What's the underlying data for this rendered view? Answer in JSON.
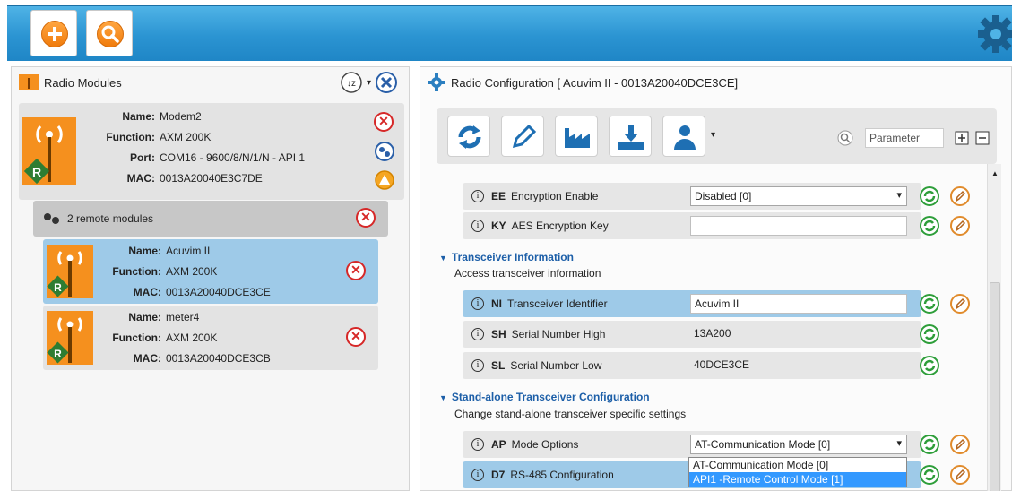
{
  "toolbar": {
    "add_label": "",
    "search_label": ""
  },
  "left_panel": {
    "title": "Radio Modules",
    "local_module": {
      "name_key": "Name:",
      "name": "Modem2",
      "function_key": "Function:",
      "function": "AXM 200K",
      "port_key": "Port:",
      "port": "COM16 - 9600/8/N/1/N - API 1",
      "mac_key": "MAC:",
      "mac": "0013A20040E3C7DE"
    },
    "remote_header": "2 remote modules",
    "remotes": [
      {
        "name_key": "Name:",
        "name": "Acuvim II",
        "function_key": "Function:",
        "function": "AXM 200K",
        "mac_key": "MAC:",
        "mac": "0013A20040DCE3CE"
      },
      {
        "name_key": "Name:",
        "name": "meter4",
        "function_key": "Function:",
        "function": "AXM 200K",
        "mac_key": "MAC:",
        "mac": "0013A20040DCE3CB"
      }
    ]
  },
  "right_panel": {
    "title": "Radio Configuration [ Acuvim II - 0013A20040DCE3CE]",
    "search_placeholder": "Parameter",
    "params": [
      {
        "code": "EE",
        "label": "Encryption Enable",
        "value": "Disabled [0]"
      },
      {
        "code": "KY",
        "label": "AES Encryption Key",
        "value": ""
      },
      {
        "code": "NI",
        "label": "Transceiver Identifier",
        "value": "Acuvim II"
      },
      {
        "code": "SH",
        "label": "Serial Number High",
        "value": "13A200"
      },
      {
        "code": "SL",
        "label": "Serial Number Low",
        "value": "40DCE3CE"
      },
      {
        "code": "AP",
        "label": "Mode Options",
        "value": "AT-Communication Mode [0]"
      },
      {
        "code": "D7",
        "label": "RS-485 Configuration",
        "value": ""
      }
    ],
    "sections": [
      {
        "title": "Transceiver Information",
        "desc": "Access transceiver information"
      },
      {
        "title": "Stand-alone Transceiver Configuration",
        "desc": "Change stand-alone transceiver specific settings"
      }
    ],
    "dropdown_options": [
      "AT-Communication Mode [0]",
      "API1 -Remote Control Mode [1]"
    ]
  },
  "colors": {
    "accent": "#2b94d2",
    "selected": "#9ecae8",
    "section_title": "#1d5fa8",
    "orange": "#f5901e"
  }
}
